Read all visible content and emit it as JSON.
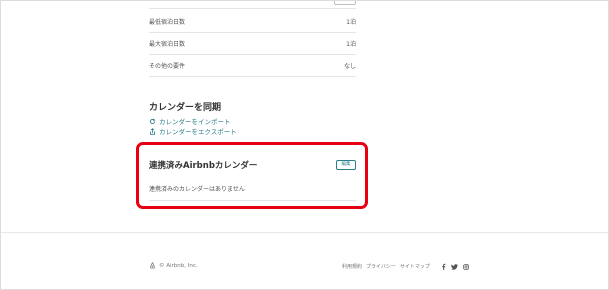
{
  "rows": [
    {
      "label": "最低宿泊日数",
      "value": "1泊"
    },
    {
      "label": "最大宿泊日数",
      "value": "1泊"
    },
    {
      "label": "その他の要件",
      "value": "なし"
    }
  ],
  "sync": {
    "title": "カレンダーを同期",
    "import_label": "カレンダーをインポート",
    "export_label": "カレンダーをエクスポート"
  },
  "connected": {
    "title": "連携済みAirbnbカレンダー",
    "edit_label": "編集",
    "empty_text": "連携済みのカレンダーはありません"
  },
  "footer": {
    "copyright": "© Airbnb, Inc.",
    "links": [
      "利用規約",
      "プライバシー",
      "サイトマップ"
    ],
    "social_icons": [
      "facebook-icon",
      "twitter-icon",
      "instagram-icon"
    ]
  },
  "colors": {
    "accent": "#2a7f8a",
    "highlight": "#e60012",
    "text": "#484848"
  }
}
